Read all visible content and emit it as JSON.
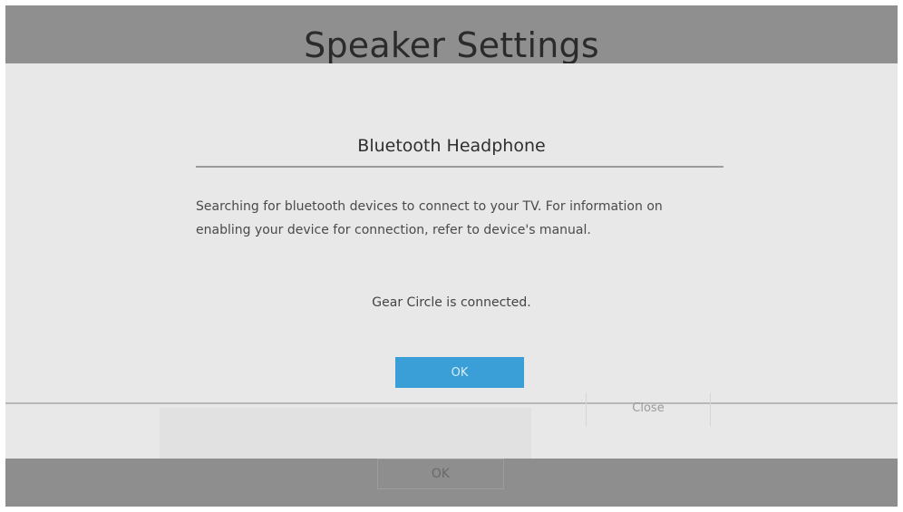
{
  "page": {
    "title": "Speaker Settings",
    "background_ok_label": "OK",
    "background_close_label": "Close"
  },
  "dialog": {
    "title": "Bluetooth Headphone",
    "message": "Searching for bluetooth devices to connect to your TV. For information on enabling your device for connection, refer to device's manual.",
    "status": "Gear Circle is connected.",
    "ok_label": "OK"
  },
  "colors": {
    "accent_button": "#3a9fd6",
    "dialog_background": "#e8e8e8",
    "dimmed_background": "#8f8f8f"
  }
}
